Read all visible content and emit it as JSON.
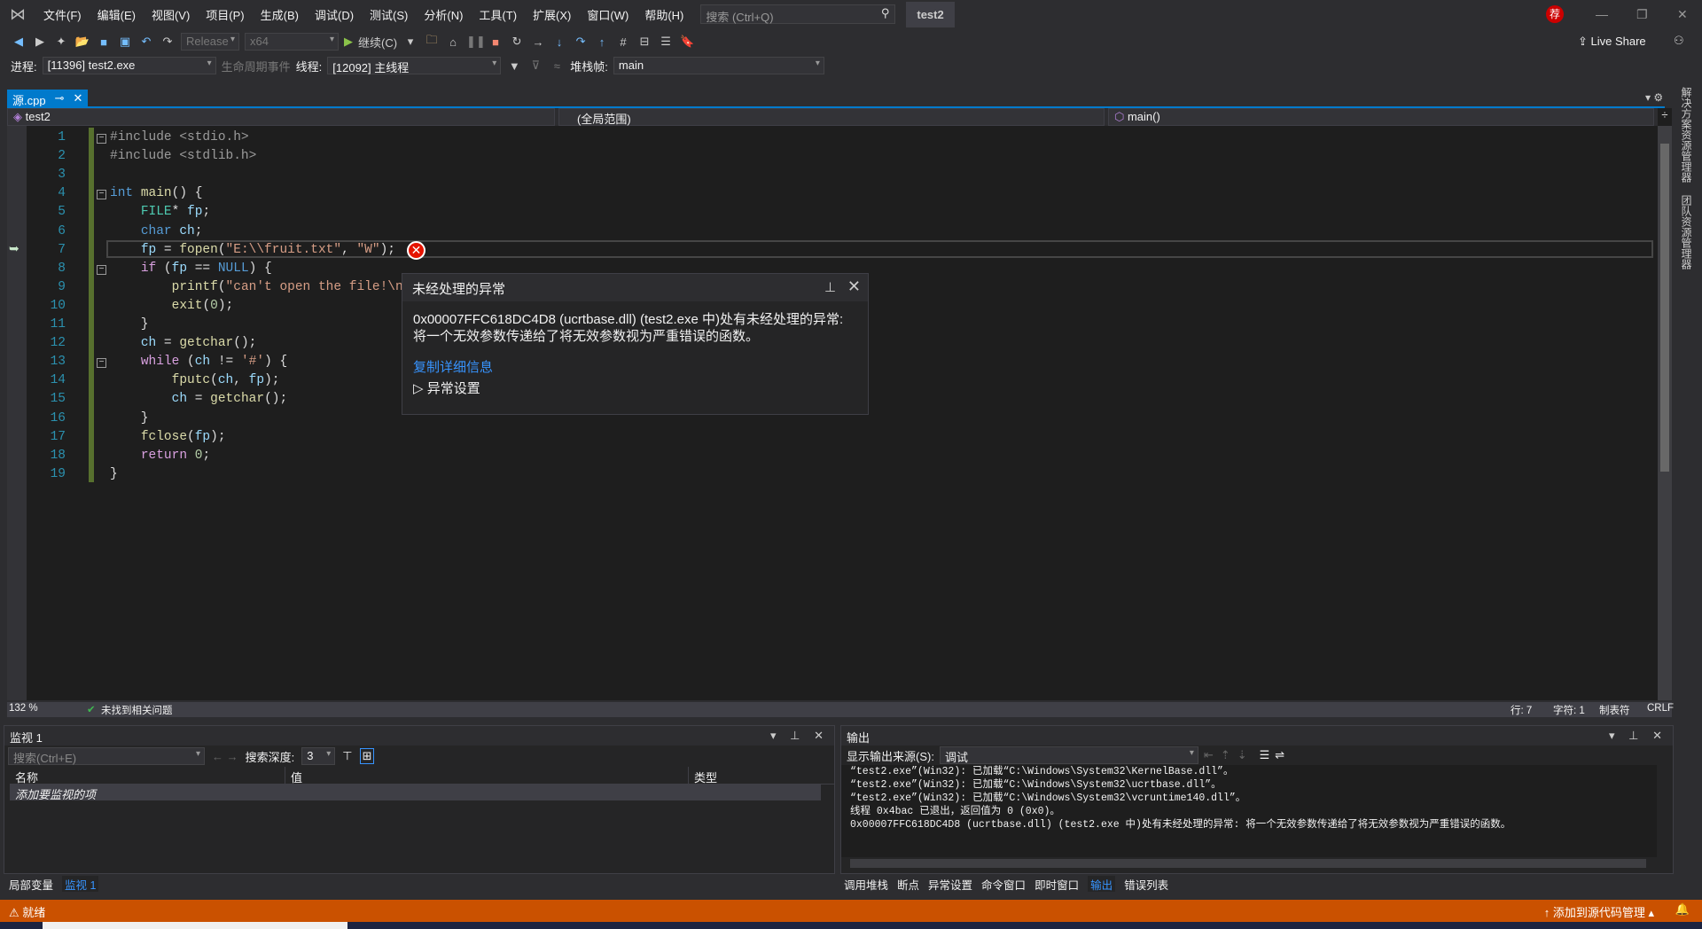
{
  "menu": {
    "items": [
      "文件(F)",
      "编辑(E)",
      "视图(V)",
      "项目(P)",
      "生成(B)",
      "调试(D)",
      "测试(S)",
      "分析(N)",
      "工具(T)",
      "扩展(X)",
      "窗口(W)",
      "帮助(H)"
    ],
    "search_placeholder": "搜索 (Ctrl+Q)",
    "title": "test2",
    "badge": "荐"
  },
  "toolbar": {
    "config": "Release",
    "platform": "x64",
    "continue": "继续(C)",
    "live_share": "Live Share"
  },
  "debugbar": {
    "process_label": "进程:",
    "process": "[11396] test2.exe",
    "lifecycle": "生命周期事件",
    "thread_label": "线程:",
    "thread": "[12092] 主线程",
    "stack_label": "堆栈帧:",
    "stack": "main"
  },
  "editor": {
    "tab": "源.cpp",
    "nav_project": "test2",
    "nav_scope": "(全局范围)",
    "nav_member": "main()",
    "lines": [
      [
        [
          "pp",
          "#include <stdio.h>"
        ]
      ],
      [
        [
          "pp",
          "#include <stdlib.h>"
        ]
      ],
      [],
      [
        [
          "kw",
          "int"
        ],
        [
          "pl",
          " "
        ],
        [
          "fn",
          "main"
        ],
        [
          "pl",
          "() {"
        ]
      ],
      [
        [
          "pl",
          "    "
        ],
        [
          "ty",
          "FILE"
        ],
        [
          "pl",
          "* "
        ],
        [
          "var",
          "fp"
        ],
        [
          "pl",
          ";"
        ]
      ],
      [
        [
          "pl",
          "    "
        ],
        [
          "kw",
          "char"
        ],
        [
          "pl",
          " "
        ],
        [
          "var",
          "ch"
        ],
        [
          "pl",
          ";"
        ]
      ],
      [
        [
          "pl",
          "    "
        ],
        [
          "var",
          "fp"
        ],
        [
          "pl",
          " = "
        ],
        [
          "fn",
          "fopen"
        ],
        [
          "pl",
          "("
        ],
        [
          "str",
          "\"E:\\\\fruit.txt\""
        ],
        [
          "pl",
          ", "
        ],
        [
          "str",
          "\"W\""
        ],
        [
          "pl",
          ");"
        ]
      ],
      [
        [
          "pl",
          "    "
        ],
        [
          "ctl",
          "if"
        ],
        [
          "pl",
          " ("
        ],
        [
          "var",
          "fp"
        ],
        [
          "pl",
          " == "
        ],
        [
          "kw",
          "NULL"
        ],
        [
          "pl",
          ") {"
        ]
      ],
      [
        [
          "pl",
          "        "
        ],
        [
          "fn",
          "printf"
        ],
        [
          "pl",
          "("
        ],
        [
          "str",
          "\"can't open the file!\\n\""
        ],
        [
          "pl",
          ");"
        ]
      ],
      [
        [
          "pl",
          "        "
        ],
        [
          "fn",
          "exit"
        ],
        [
          "pl",
          "("
        ],
        [
          "num",
          "0"
        ],
        [
          "pl",
          ");"
        ]
      ],
      [
        [
          "pl",
          "    }"
        ]
      ],
      [
        [
          "pl",
          "    "
        ],
        [
          "var",
          "ch"
        ],
        [
          "pl",
          " = "
        ],
        [
          "fn",
          "getchar"
        ],
        [
          "pl",
          "();"
        ]
      ],
      [
        [
          "pl",
          "    "
        ],
        [
          "ctl",
          "while"
        ],
        [
          "pl",
          " ("
        ],
        [
          "var",
          "ch"
        ],
        [
          "pl",
          " != "
        ],
        [
          "str",
          "'#'"
        ],
        [
          "pl",
          ") {"
        ]
      ],
      [
        [
          "pl",
          "        "
        ],
        [
          "fn",
          "fputc"
        ],
        [
          "pl",
          "("
        ],
        [
          "var",
          "ch"
        ],
        [
          "pl",
          ", "
        ],
        [
          "var",
          "fp"
        ],
        [
          "pl",
          ");"
        ]
      ],
      [
        [
          "pl",
          "        "
        ],
        [
          "var",
          "ch"
        ],
        [
          "pl",
          " = "
        ],
        [
          "fn",
          "getchar"
        ],
        [
          "pl",
          "();"
        ]
      ],
      [
        [
          "pl",
          "    }"
        ]
      ],
      [
        [
          "pl",
          "    "
        ],
        [
          "fn",
          "fclose"
        ],
        [
          "pl",
          "("
        ],
        [
          "var",
          "fp"
        ],
        [
          "pl",
          ");"
        ]
      ],
      [
        [
          "pl",
          "    "
        ],
        [
          "ctl",
          "return"
        ],
        [
          "pl",
          " "
        ],
        [
          "num",
          "0"
        ],
        [
          "pl",
          ";"
        ]
      ],
      [
        [
          "pl",
          "}"
        ]
      ]
    ],
    "zoom": "132 %",
    "issues": "未找到相关问题",
    "row": "行: 7",
    "col": "字符: 1",
    "tabs": "制表符",
    "eol": "CRLF"
  },
  "exception": {
    "title": "未经处理的异常",
    "message": "0x00007FFC618DC4D8 (ucrtbase.dll) (test2.exe 中)处有未经处理的异常: 将一个无效参数传递给了将无效参数视为严重错误的函数。",
    "copy_details": "复制详细信息",
    "settings": "异常设置"
  },
  "watch": {
    "title": "监视 1",
    "search_placeholder": "搜索(Ctrl+E)",
    "depth_label": "搜索深度:",
    "depth": "3",
    "columns": [
      "名称",
      "值",
      "类型"
    ],
    "add_item": "添加要监视的项",
    "tabs": [
      "局部变量",
      "监视 1"
    ]
  },
  "output": {
    "title": "输出",
    "source_label": "显示输出来源(S):",
    "source": "调试",
    "lines": [
      "“test2.exe”(Win32): 已加载“C:\\Windows\\System32\\KernelBase.dll”。",
      "“test2.exe”(Win32): 已加载“C:\\Windows\\System32\\ucrtbase.dll”。",
      "“test2.exe”(Win32): 已加载“C:\\Windows\\System32\\vcruntime140.dll”。",
      "线程 0x4bac 已退出，返回值为 0 (0x0)。",
      "0x00007FFC618DC4D8 (ucrtbase.dll) (test2.exe 中)处有未经处理的异常: 将一个无效参数传递给了将无效参数视为严重错误的函数。"
    ],
    "tabs": [
      "调用堆栈",
      "断点",
      "异常设置",
      "命令窗口",
      "即时窗口",
      "输出",
      "错误列表"
    ]
  },
  "side_tabs": [
    "解决方案资源管理器",
    "团队资源管理器"
  ],
  "status": {
    "ready": "就绪",
    "source_control": "添加到源代码管理"
  },
  "colors": {
    "accent": "#007acc",
    "status_bar": "#ca5100",
    "error": "#e51400"
  }
}
